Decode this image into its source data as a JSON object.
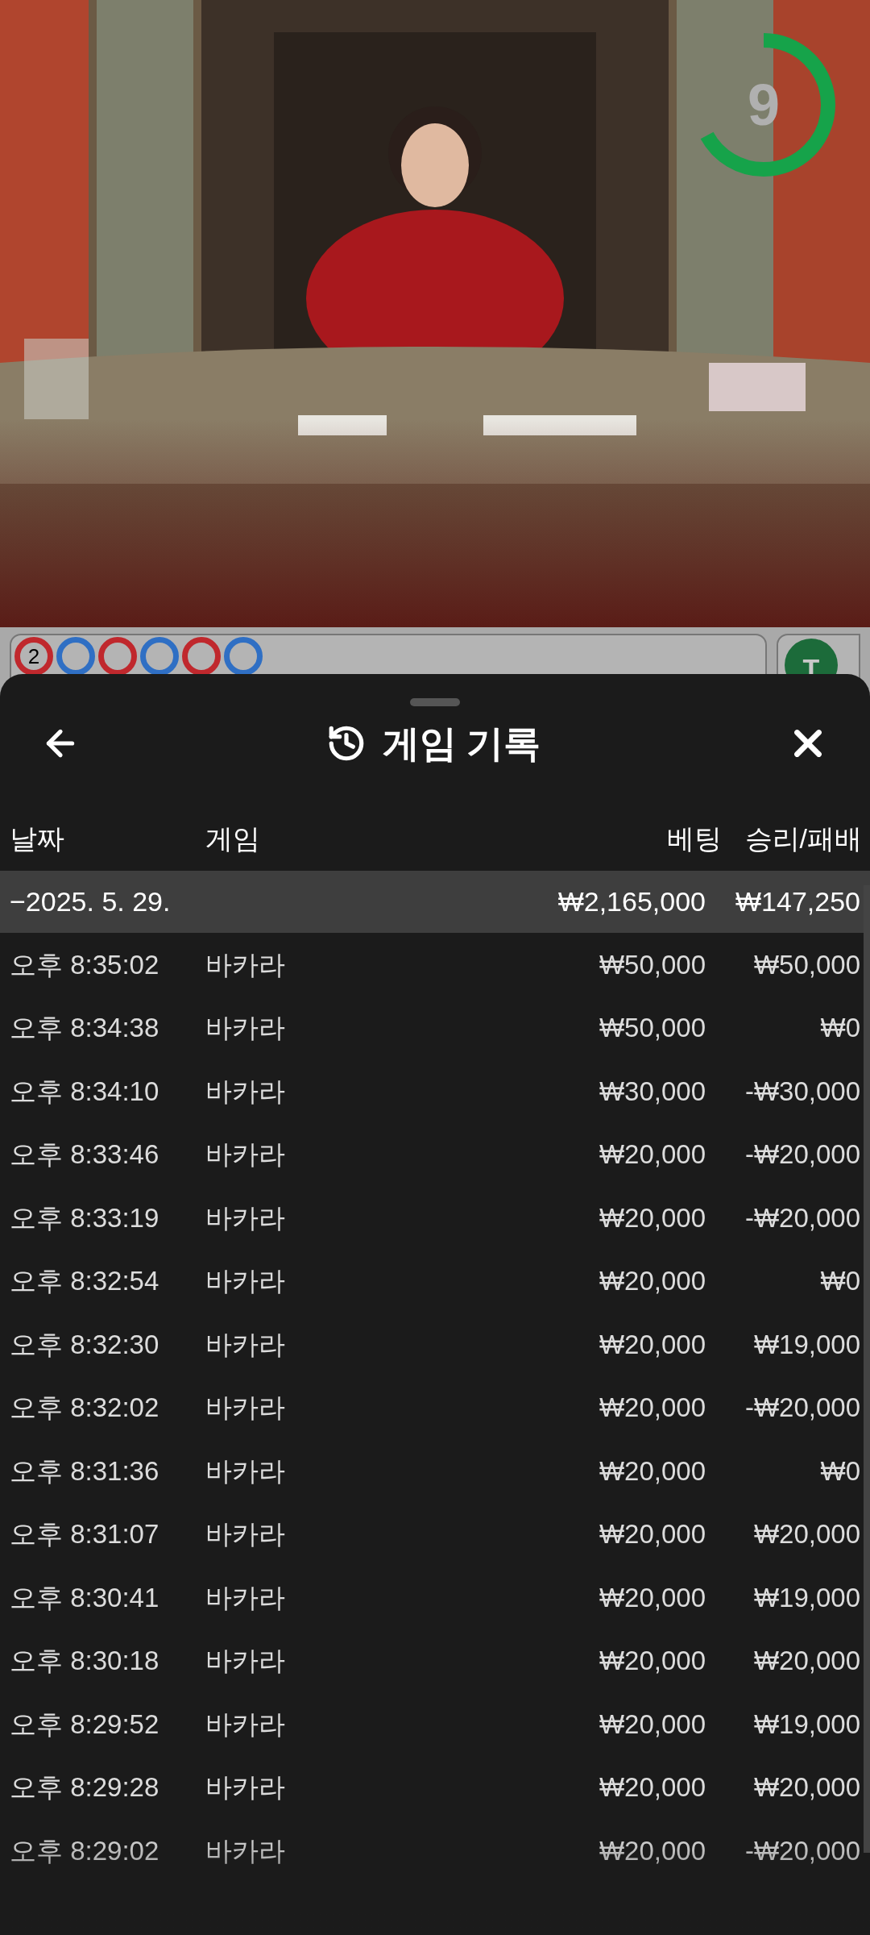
{
  "timer": {
    "value": "9"
  },
  "roadmap": {
    "cells": [
      {
        "color": "#c0282d",
        "count": "2"
      },
      {
        "color": "#2f6fc4"
      },
      {
        "color": "#c0282d"
      },
      {
        "color": "#2f6fc4"
      },
      {
        "color": "#c0282d"
      },
      {
        "color": "#2f6fc4"
      }
    ],
    "badge": "T"
  },
  "sheet": {
    "title": "게임 기록",
    "columns": [
      "날짜",
      "게임",
      "베팅",
      "승리/패배"
    ],
    "summary": {
      "date": "−2025. 5. 29.",
      "bet": "₩2,165,000",
      "result": "₩147,250"
    },
    "rows": [
      {
        "time": "오후 8:35:02",
        "game": "바카라",
        "bet": "₩50,000",
        "result": "₩50,000"
      },
      {
        "time": "오후 8:34:38",
        "game": "바카라",
        "bet": "₩50,000",
        "result": "₩0"
      },
      {
        "time": "오후 8:34:10",
        "game": "바카라",
        "bet": "₩30,000",
        "result": "-₩30,000"
      },
      {
        "time": "오후 8:33:46",
        "game": "바카라",
        "bet": "₩20,000",
        "result": "-₩20,000"
      },
      {
        "time": "오후 8:33:19",
        "game": "바카라",
        "bet": "₩20,000",
        "result": "-₩20,000"
      },
      {
        "time": "오후 8:32:54",
        "game": "바카라",
        "bet": "₩20,000",
        "result": "₩0"
      },
      {
        "time": "오후 8:32:30",
        "game": "바카라",
        "bet": "₩20,000",
        "result": "₩19,000"
      },
      {
        "time": "오후 8:32:02",
        "game": "바카라",
        "bet": "₩20,000",
        "result": "-₩20,000"
      },
      {
        "time": "오후 8:31:36",
        "game": "바카라",
        "bet": "₩20,000",
        "result": "₩0"
      },
      {
        "time": "오후 8:31:07",
        "game": "바카라",
        "bet": "₩20,000",
        "result": "₩20,000"
      },
      {
        "time": "오후 8:30:41",
        "game": "바카라",
        "bet": "₩20,000",
        "result": "₩19,000"
      },
      {
        "time": "오후 8:30:18",
        "game": "바카라",
        "bet": "₩20,000",
        "result": "₩20,000"
      },
      {
        "time": "오후 8:29:52",
        "game": "바카라",
        "bet": "₩20,000",
        "result": "₩19,000"
      },
      {
        "time": "오후 8:29:28",
        "game": "바카라",
        "bet": "₩20,000",
        "result": "₩20,000"
      },
      {
        "time": "오후 8:29:02",
        "game": "바카라",
        "bet": "₩20,000",
        "result": "-₩20,000"
      }
    ]
  }
}
